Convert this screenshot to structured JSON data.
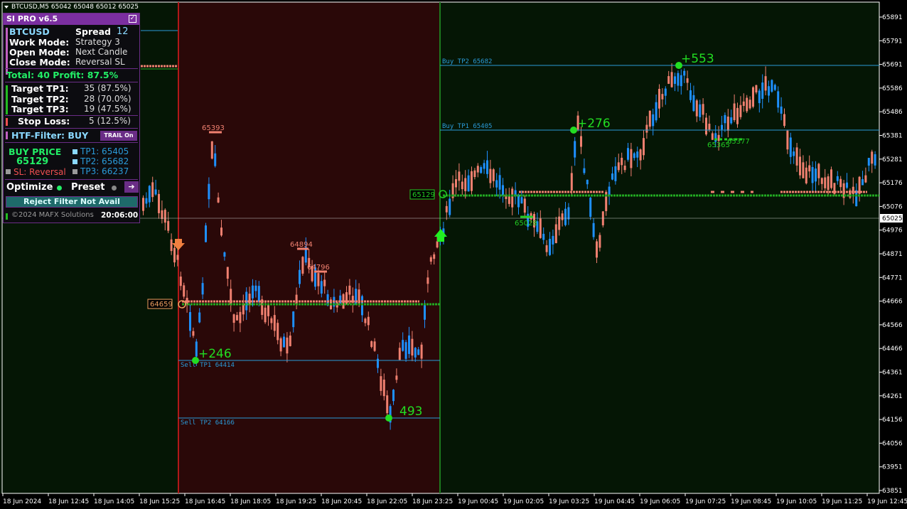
{
  "chart": {
    "symbol_header": "BTCUSD,M5  65042 65048 65012 65025",
    "price_labels": [
      "65891",
      "65791",
      "65691",
      "65586",
      "65486",
      "65381",
      "65281",
      "65176",
      "65076",
      "64976",
      "64871",
      "64771",
      "64666",
      "64566",
      "64466",
      "64361",
      "64261",
      "64156",
      "64056",
      "63951",
      "63851"
    ],
    "current_price": "65025",
    "time_labels": [
      "18 Jun 2024",
      "18 Jun 12:45",
      "18 Jun 14:05",
      "18 Jun 15:25",
      "18 Jun 16:45",
      "18 Jun 18:05",
      "18 Jun 19:25",
      "18 Jun 20:45",
      "18 Jun 22:05",
      "18 Jun 23:25",
      "19 Jun 00:45",
      "19 Jun 02:05",
      "19 Jun 03:25",
      "19 Jun 04:45",
      "19 Jun 06:05",
      "19 Jun 07:25",
      "19 Jun 08:45",
      "19 Jun 10:05",
      "19 Jun 11:25",
      "19 Jun 12:45"
    ],
    "level_labels": {
      "buy_tp2": "Buy TP2 65682",
      "buy_tp1": "Buy TP1 65405",
      "sell_tp1": "Sell TP1 64414",
      "sell_tp2": "Sell TP2 64166"
    },
    "entry_labels": {
      "buy": "65129",
      "sell": "64659"
    },
    "profit_labels": {
      "p246": "+246",
      "p493": "493",
      "p276": "+276",
      "p553": "+553"
    },
    "swing_labels": {
      "s65393": "65393",
      "s64894": "64894",
      "s64796": "64796",
      "s65028": "65028",
      "s65365": "65365",
      "s65377": "65377"
    },
    "colors": {
      "background": "#000000",
      "sell_zone": "#2a0808",
      "buy_zone": "#051605",
      "bull_candle": "#1e90ff",
      "bear_candle": "#f08070",
      "grid": "#ffffff",
      "buy_line": "#1e7a1e",
      "sell_line": "#b01818",
      "level_line": "#2a9ad8",
      "signal_green": "#22dd22"
    }
  },
  "panel": {
    "title": "SI PRO v6.5",
    "symbol": "BTCUSD",
    "spread_label": "Spread",
    "spread_value": "12",
    "work_mode_label": "Work  Mode:",
    "work_mode_value": "Strategy 3",
    "open_mode_label": "Open  Mode:",
    "open_mode_value": "Next Candle",
    "close_mode_label": "Close Mode:",
    "close_mode_value": "Reversal SL",
    "total": "Total: 40  Profit: 87.5%",
    "tp1_label": "Target TP1:",
    "tp1_value": "35 (87.5%)",
    "tp2_label": "Target TP2:",
    "tp2_value": "28 (70.0%)",
    "tp3_label": "Target TP3:",
    "tp3_value": "19 (47.5%)",
    "sl_label": "Stop Loss:",
    "sl_value": "5 (12.5%)",
    "htf_filter": "HTF-Filter:  BUY",
    "trail_button": "TRAIL On",
    "buy_price_label": "BUY PRICE",
    "buy_price_value": "65129",
    "sl_text": "SL: Reversal",
    "tp1_text": "TP1: 65405",
    "tp2_text": "TP2: 65682",
    "tp3_text": "TP3: 66237",
    "optimize_label": "Optimize",
    "preset_label": "Preset",
    "reject_button": "Reject Filter Not Avail",
    "copyright": "©2024 MAFX Solutions",
    "clock": "20:06:00"
  }
}
